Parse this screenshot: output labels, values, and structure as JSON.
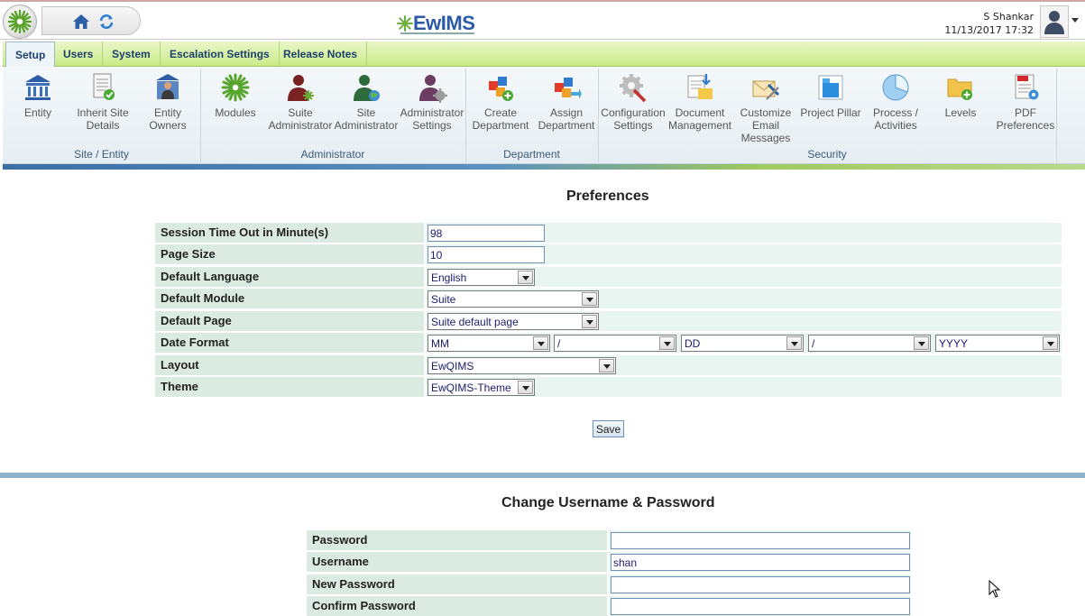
{
  "header": {
    "logo_text": "EwIMS",
    "user_name": "S Shankar",
    "datetime": "11/13/2017 17:32"
  },
  "tabs": [
    {
      "label": "Setup",
      "active": true
    },
    {
      "label": "Users",
      "active": false
    },
    {
      "label": "System",
      "active": false
    },
    {
      "label": "Escalation Settings",
      "active": false
    },
    {
      "label": "Release Notes",
      "active": false
    }
  ],
  "ribbon": {
    "buttons": [
      {
        "label": "Entity",
        "icon": "bank-icon"
      },
      {
        "label": "Inherit Site Details",
        "icon": "document-check-icon"
      },
      {
        "label": "Entity Owners",
        "icon": "building-person-icon"
      },
      {
        "label": "Modules",
        "icon": "modules-gear-icon"
      },
      {
        "label": "Suite Administrator",
        "icon": "admin-user-icon"
      },
      {
        "label": "Site Administrator",
        "icon": "site-admin-globe-icon"
      },
      {
        "label": "Administrator Settings",
        "icon": "admin-settings-icon"
      },
      {
        "label": "Create Department",
        "icon": "create-department-icon"
      },
      {
        "label": "Assign Department",
        "icon": "assign-department-icon"
      },
      {
        "label": "Configuration Settings",
        "icon": "configuration-icon"
      },
      {
        "label": "Document Management",
        "icon": "document-management-icon"
      },
      {
        "label": "Customize Email Messages",
        "icon": "email-customize-icon"
      },
      {
        "label": "Project Pillar",
        "icon": "project-pillar-icon"
      },
      {
        "label": "Process / Activities",
        "icon": "pie-process-icon"
      },
      {
        "label": "Levels",
        "icon": "folder-add-icon"
      },
      {
        "label": "PDF Preferences",
        "icon": "pdf-preferences-icon"
      }
    ],
    "groups": [
      "Site / Entity",
      "Administrator",
      "Department",
      "Security"
    ]
  },
  "preferences": {
    "title": "Preferences",
    "rows": [
      {
        "label": "Session Time Out in Minute(s)",
        "value": "98"
      },
      {
        "label": "Page Size",
        "value": "10"
      },
      {
        "label": "Default Language",
        "value": "English"
      },
      {
        "label": "Default Module",
        "value": "Suite"
      },
      {
        "label": "Default Page",
        "value": "Suite default page"
      },
      {
        "label": "Date Format",
        "values": [
          "MM",
          "/",
          "DD",
          "/",
          "YYYY"
        ]
      },
      {
        "label": "Layout",
        "value": "EwQIMS"
      },
      {
        "label": "Theme",
        "value": "EwQIMS-Theme"
      }
    ],
    "save_label": "Save"
  },
  "account": {
    "title": "Change Username & Password",
    "rows": [
      {
        "label": "Password",
        "value": ""
      },
      {
        "label": "Username",
        "value": "shan"
      },
      {
        "label": "New Password",
        "value": ""
      },
      {
        "label": "Confirm Password",
        "value": ""
      }
    ]
  },
  "colors": {
    "tab_green": "#c9ea87",
    "label_bg": "#dcebe2",
    "value_bg": "#e9f5f0",
    "divider": "#8fb2c8"
  }
}
